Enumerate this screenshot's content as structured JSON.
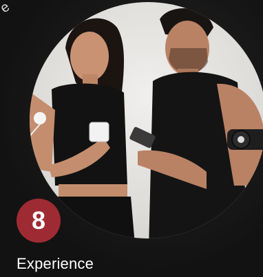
{
  "step": {
    "number": "8",
    "title": "Experience",
    "badge_color": "#9e2b34"
  },
  "colors": {
    "background": "#161616",
    "circle": "#e7e6e4",
    "text": "#ffffff"
  },
  "icons": {
    "corner": "partial-logo-icon"
  }
}
